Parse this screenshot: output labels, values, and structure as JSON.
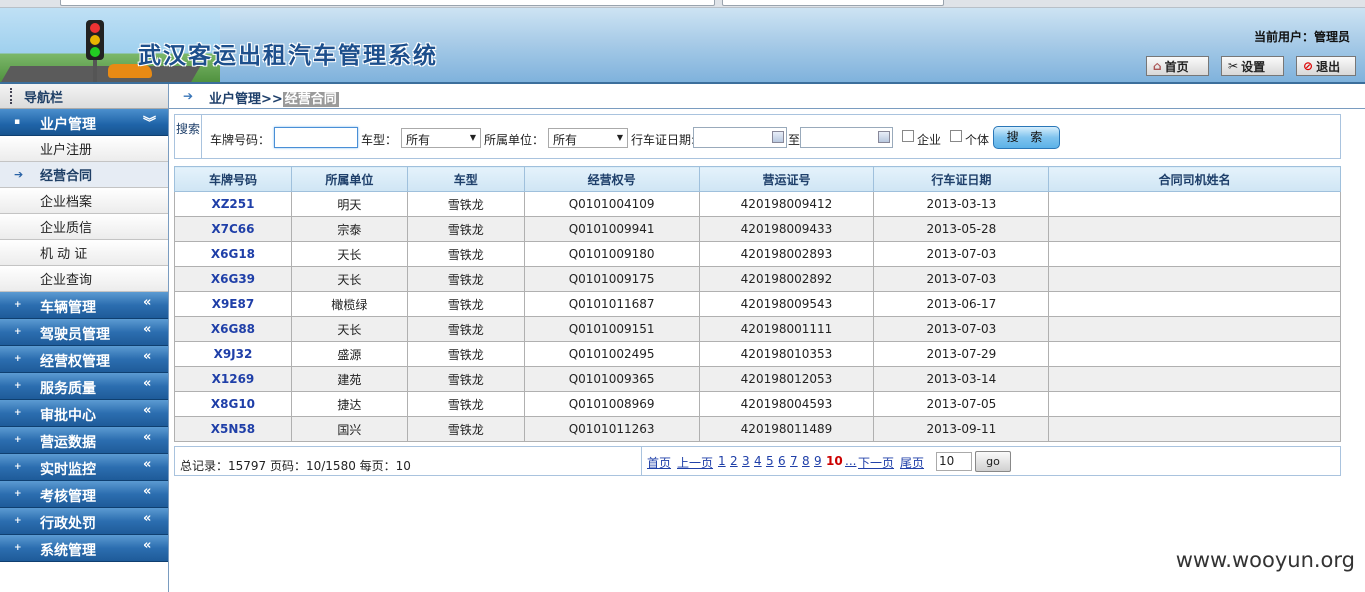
{
  "header": {
    "app_title": "武汉客运出租汽车管理系统",
    "user_info": "当前用户：管理员",
    "buttons": {
      "home": "首页",
      "settings": "设置",
      "logout": "退出"
    }
  },
  "sidebar": {
    "title": "导航栏",
    "groups": [
      {
        "label": "业户管理",
        "open": true
      },
      {
        "label": "车辆管理"
      },
      {
        "label": "驾驶员管理"
      },
      {
        "label": "经营权管理"
      },
      {
        "label": "服务质量"
      },
      {
        "label": "审批中心"
      },
      {
        "label": "营运数据"
      },
      {
        "label": "实时监控"
      },
      {
        "label": "考核管理"
      },
      {
        "label": "行政处罚"
      },
      {
        "label": "系统管理"
      }
    ],
    "sub_items": [
      "业户注册",
      "经营合同",
      "企业档案",
      "企业质信",
      "机 动 证",
      "企业查询"
    ],
    "active_sub": "经营合同"
  },
  "breadcrumb": {
    "parent": "业户管理>>",
    "current": "经营合同"
  },
  "search": {
    "tag": "搜索",
    "plate_label": "车牌号码：",
    "plate_value": "",
    "type_label": "车型：",
    "type_value": "所有",
    "unit_label": "所属单位：",
    "unit_value": "所有",
    "date_label": "行车证日期:",
    "date_to": "至",
    "company_label": "企业",
    "individual_label": "个体",
    "button": "搜 索"
  },
  "table": {
    "headers": [
      "车牌号码",
      "所属单位",
      "车型",
      "经营权号",
      "营运证号",
      "行车证日期",
      "合同司机姓名"
    ],
    "rows": [
      [
        "XZ251",
        "明天",
        "雪铁龙",
        "Q0101004109",
        "420198009412",
        "2013-03-13",
        ""
      ],
      [
        "X7C66",
        "宗泰",
        "雪铁龙",
        "Q0101009941",
        "420198009433",
        "2013-05-28",
        ""
      ],
      [
        "X6G18",
        "天长",
        "雪铁龙",
        "Q0101009180",
        "420198002893",
        "2013-07-03",
        ""
      ],
      [
        "X6G39",
        "天长",
        "雪铁龙",
        "Q0101009175",
        "420198002892",
        "2013-07-03",
        ""
      ],
      [
        "X9E87",
        "橄榄绿",
        "雪铁龙",
        "Q0101011687",
        "420198009543",
        "2013-06-17",
        ""
      ],
      [
        "X6G88",
        "天长",
        "雪铁龙",
        "Q0101009151",
        "420198001111",
        "2013-07-03",
        ""
      ],
      [
        "X9J32",
        "盛源",
        "雪铁龙",
        "Q0101002495",
        "420198010353",
        "2013-07-29",
        ""
      ],
      [
        "X1269",
        "建苑",
        "雪铁龙",
        "Q0101009365",
        "420198012053",
        "2013-03-14",
        ""
      ],
      [
        "X8G10",
        "捷达",
        "雪铁龙",
        "Q0101008969",
        "420198004593",
        "2013-07-05",
        ""
      ],
      [
        "X5N58",
        "国兴",
        "雪铁龙",
        "Q0101011263",
        "420198011489",
        "2013-09-11",
        ""
      ]
    ]
  },
  "pager": {
    "summary": "总记录：15797 页码：10/1580 每页：10",
    "first": "首页",
    "prev": "上一页",
    "pages": [
      "1",
      "2",
      "3",
      "4",
      "5",
      "6",
      "7",
      "8",
      "9",
      "10",
      "..."
    ],
    "current_page": "10",
    "next": "下一页",
    "last": "尾页",
    "goto_value": "10",
    "go_label": "go"
  },
  "watermark": "www.wooyun.org"
}
